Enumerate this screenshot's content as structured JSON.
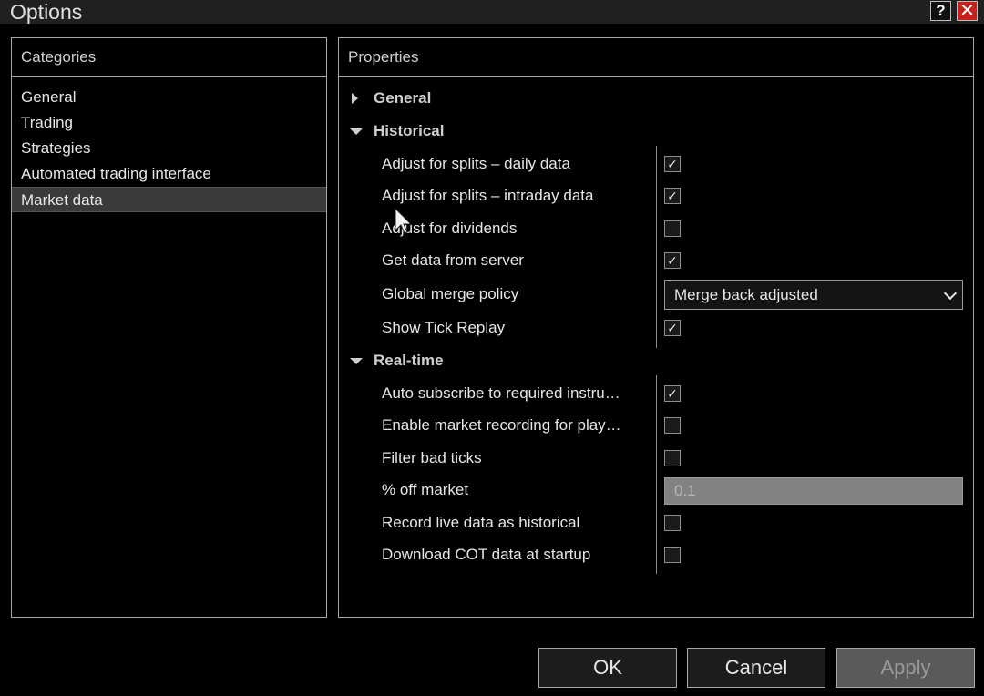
{
  "window": {
    "title": "Options",
    "help_label": "?",
    "close_label": "✕"
  },
  "categories": {
    "header": "Categories",
    "items": [
      {
        "label": "General"
      },
      {
        "label": "Trading"
      },
      {
        "label": "Strategies"
      },
      {
        "label": "Automated trading interface"
      },
      {
        "label": "Market data",
        "selected": true
      }
    ]
  },
  "properties": {
    "header": "Properties",
    "sections": {
      "general": {
        "label": "General",
        "expanded": false
      },
      "historical": {
        "label": "Historical",
        "expanded": true,
        "items": [
          {
            "label": "Adjust for splits – daily data",
            "checked": true
          },
          {
            "label": "Adjust for splits – intraday data",
            "checked": true
          },
          {
            "label": "Adjust for dividends",
            "checked": false
          },
          {
            "label": "Get data from server",
            "checked": true
          },
          {
            "label": "Global merge policy",
            "value": "Merge back adjusted"
          },
          {
            "label": "Show Tick Replay",
            "checked": true
          }
        ]
      },
      "realtime": {
        "label": "Real-time",
        "expanded": true,
        "items": [
          {
            "label": "Auto subscribe to required instru…",
            "checked": true
          },
          {
            "label": "Enable market recording for play…",
            "checked": false
          },
          {
            "label": "Filter bad ticks",
            "checked": false
          },
          {
            "label": "% off market",
            "value": "0.1"
          },
          {
            "label": "Record live data as historical",
            "checked": false
          },
          {
            "label": "Download COT data at startup",
            "checked": false
          }
        ]
      }
    }
  },
  "buttons": {
    "ok": "OK",
    "cancel": "Cancel",
    "apply": "Apply"
  },
  "check_mark": "✓",
  "colors": {
    "background": "#000000",
    "border": "#a8a8a8",
    "selected": "#3a3a3a",
    "close": "#c8201c"
  }
}
